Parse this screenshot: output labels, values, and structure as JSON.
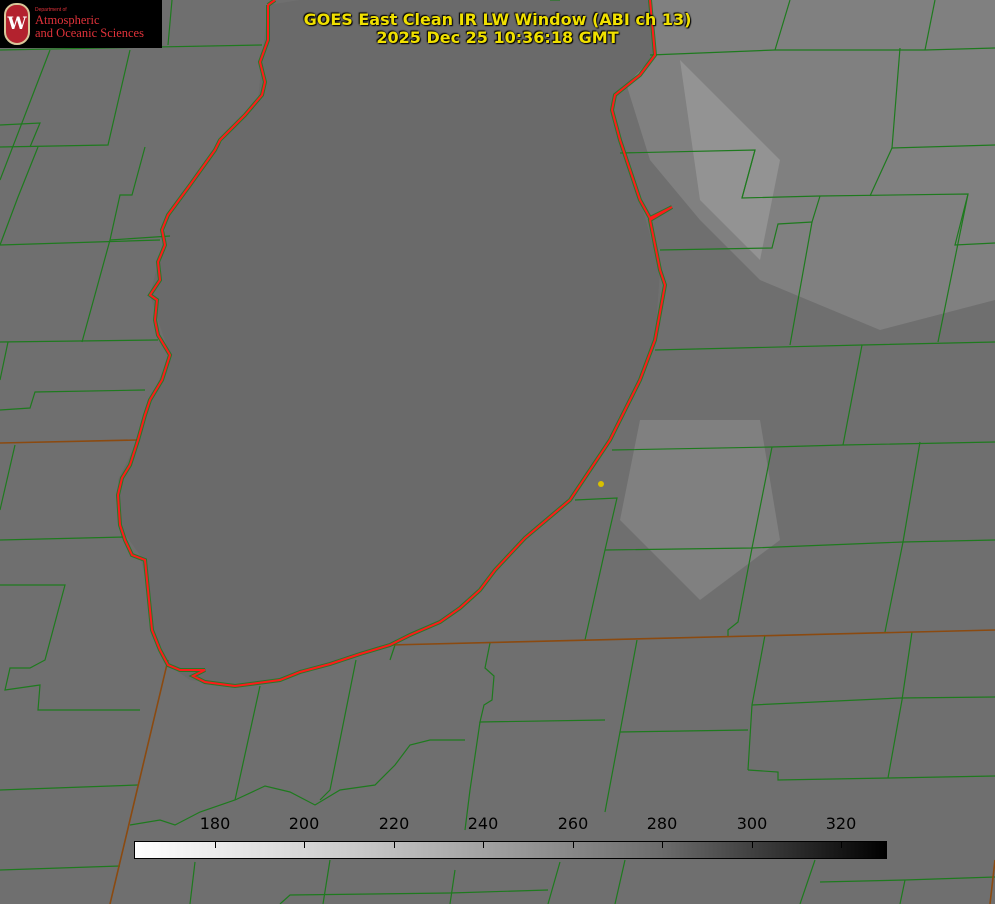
{
  "title": {
    "line1": "GOES East Clean IR LW Window (ABI ch 13)",
    "line2": "2025 Dec 25 10:36:18 GMT"
  },
  "logo": {
    "emblem_letter": "W",
    "department": "Department of",
    "line1": "Atmospheric",
    "line2": "and Oceanic Sciences"
  },
  "colorbar": {
    "ticks": [
      180,
      200,
      220,
      240,
      260,
      280,
      300,
      320
    ],
    "gradient": "white-to-black"
  },
  "colors": {
    "county_lines": "#1e7a1e",
    "shoreline": "#ff1a1a",
    "state_line": "#8b4a10",
    "marker": "#d8c000",
    "title_text": "#f0e000"
  }
}
